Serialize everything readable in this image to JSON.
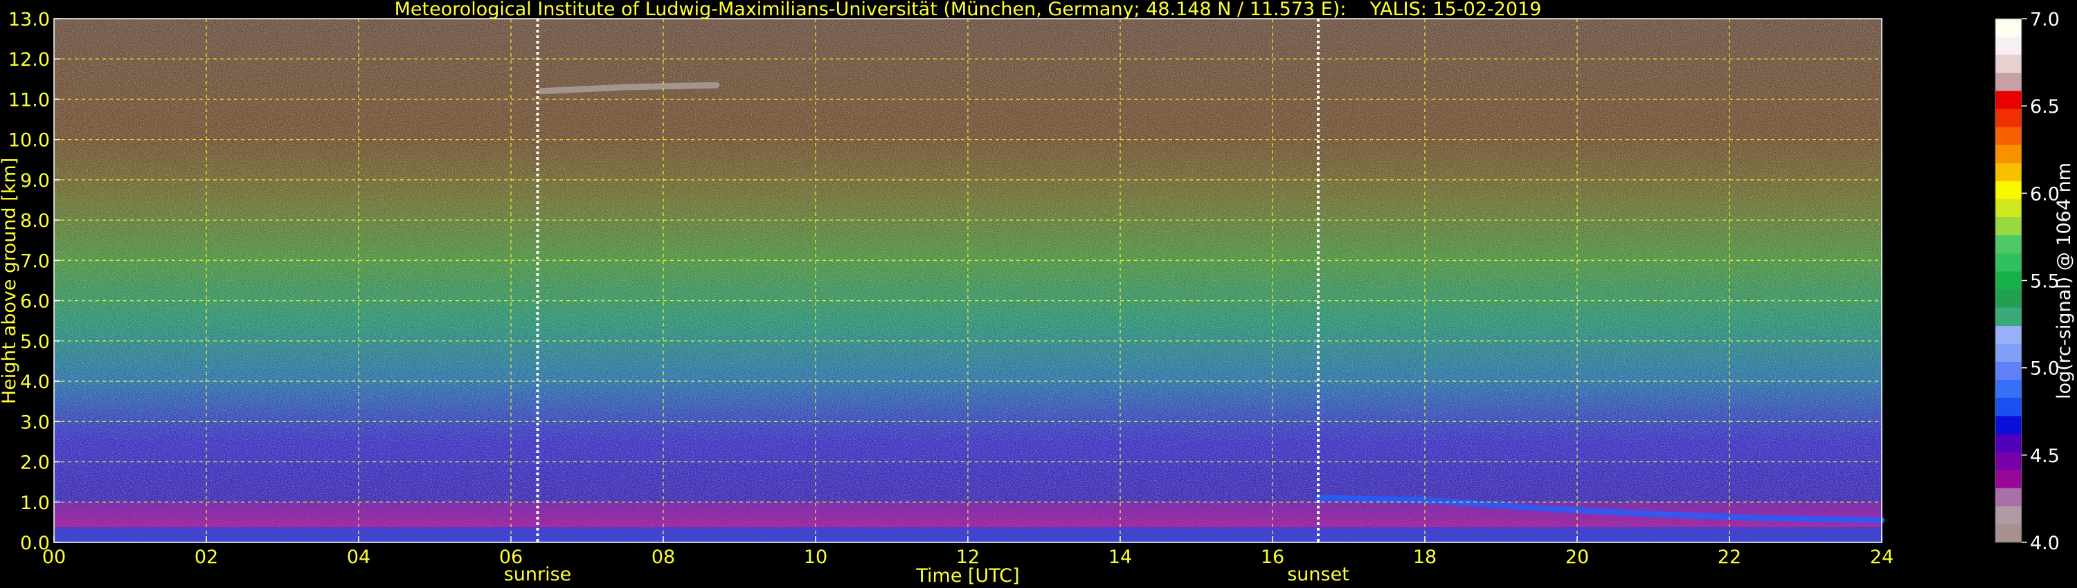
{
  "chart_data": {
    "type": "heatmap",
    "title": "Meteorological Institute of Ludwig-Maximilians-Universität (München, Germany; 48.148 N / 11.573 E):    YALIS: 15-02-2019",
    "xlabel": "Time [UTC]",
    "ylabel": "Height above ground [km]",
    "xlim": [
      0,
      24
    ],
    "ylim": [
      0,
      13
    ],
    "x_ticks": [
      "00",
      "02",
      "04",
      "06",
      "08",
      "10",
      "12",
      "14",
      "16",
      "18",
      "20",
      "22",
      "24"
    ],
    "y_ticks": [
      "0.0",
      "1.0",
      "2.0",
      "3.0",
      "4.0",
      "5.0",
      "6.0",
      "7.0",
      "8.0",
      "9.0",
      "10.0",
      "11.0",
      "12.0",
      "13.0"
    ],
    "grid": true,
    "annotations": [
      {
        "label": "sunrise",
        "x": 6.35
      },
      {
        "label": "sunset",
        "x": 16.6
      }
    ],
    "colorbar": {
      "label": "log(rc-signal) @ 1064 nm",
      "range": [
        4.0,
        7.0
      ],
      "ticks": [
        "4.0",
        "4.5",
        "5.0",
        "5.5",
        "6.0",
        "6.5",
        "7.0"
      ],
      "colors": [
        "#a89090",
        "#b09aa4",
        "#a870a8",
        "#980898",
        "#7800a8",
        "#5000b8",
        "#0a10d8",
        "#1a50f0",
        "#3870f8",
        "#6080f8",
        "#80a0f8",
        "#98b0f8",
        "#3aa878",
        "#20a050",
        "#18b048",
        "#30c060",
        "#50c868",
        "#98d840",
        "#d0e820",
        "#f8f800",
        "#f8c000",
        "#f89000",
        "#f86000",
        "#f03000",
        "#e80000",
        "#c8a0a8",
        "#e8d0d0",
        "#f8f0f0",
        "#fffff0"
      ]
    },
    "height_profile": [
      {
        "h": 0.0,
        "color": "#2a50e0"
      },
      {
        "h": 0.4,
        "color": "#9a1a9a"
      },
      {
        "h": 1.0,
        "color": "#3a2ab0"
      },
      {
        "h": 2.5,
        "color": "#3a30c0"
      },
      {
        "h": 4.0,
        "color": "#2a70a8"
      },
      {
        "h": 5.5,
        "color": "#2a9070"
      },
      {
        "h": 7.0,
        "color": "#4a9040"
      },
      {
        "h": 8.5,
        "color": "#6a7030"
      },
      {
        "h": 10.0,
        "color": "#705030"
      },
      {
        "h": 13.0,
        "color": "#6a5040"
      }
    ],
    "features": [
      {
        "name": "evening aerosol layer",
        "x": [
          16.6,
          18,
          19.5,
          21,
          22.5,
          24
        ],
        "y": [
          1.1,
          1.05,
          0.85,
          0.7,
          0.6,
          0.55
        ],
        "color": "#2060ff"
      },
      {
        "name": "high cirrus trace",
        "x": [
          6.4,
          7.5,
          8.7
        ],
        "y": [
          11.2,
          11.3,
          11.35
        ],
        "color": "#b0a0a0"
      }
    ]
  }
}
